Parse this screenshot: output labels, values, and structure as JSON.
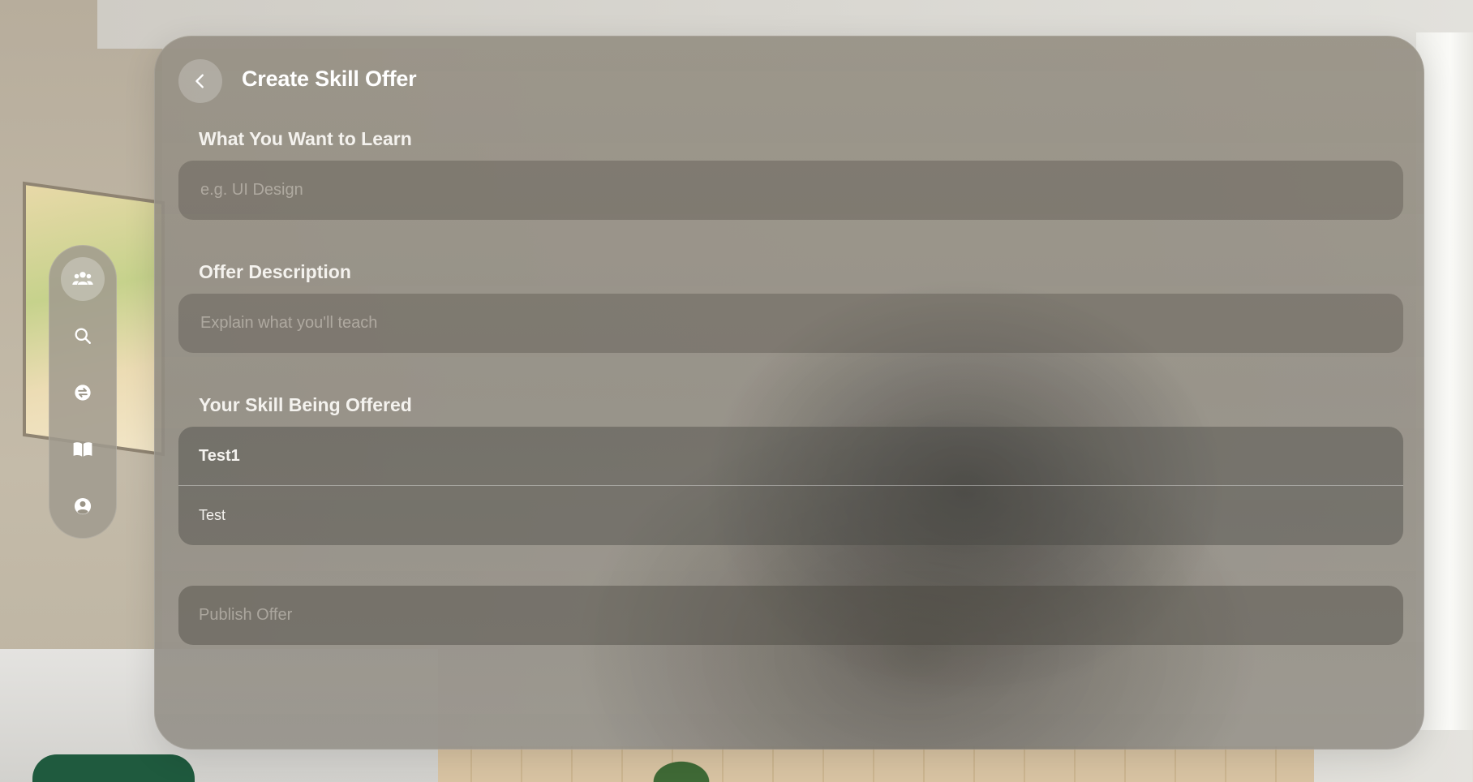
{
  "header": {
    "title": "Create Skill Offer"
  },
  "form": {
    "learn": {
      "label": "What You Want to Learn",
      "placeholder": "e.g. UI Design",
      "value": ""
    },
    "description": {
      "label": "Offer Description",
      "placeholder": "Explain what you'll teach",
      "value": ""
    },
    "skill": {
      "label": "Your Skill Being Offered",
      "selected": "Test1",
      "options": [
        "Test"
      ]
    },
    "publish_label": "Publish Offer"
  },
  "tabs": [
    {
      "icon": "people-icon",
      "active": true
    },
    {
      "icon": "search-icon",
      "active": false
    },
    {
      "icon": "exchange-icon",
      "active": false
    },
    {
      "icon": "book-icon",
      "active": false
    },
    {
      "icon": "profile-icon",
      "active": false
    }
  ],
  "colors": {
    "text_primary": "#ffffff",
    "placeholder": "#d7d2c8"
  }
}
